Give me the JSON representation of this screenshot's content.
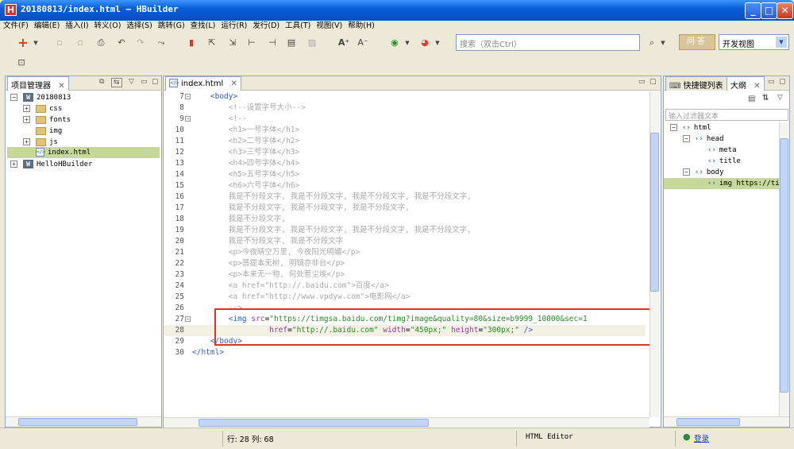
{
  "window": {
    "title": "20180813/index.html — HBuilder",
    "logo_letter": "H",
    "controls": {
      "minimize": "_",
      "maximize": "□",
      "close": "✕"
    }
  },
  "menu": [
    "文件(F)",
    "编辑(E)",
    "插入(I)",
    "转义(O)",
    "选择(S)",
    "跳转(G)",
    "查找(L)",
    "运行(R)",
    "发行(D)",
    "工具(T)",
    "视图(V)",
    "帮助(H)"
  ],
  "toolbar": {
    "search_placeholder": "搜索（双击Ctrl）",
    "qa_button": "问答",
    "view_select": "开发视图",
    "icons": [
      "new-icon",
      "save-icon",
      "save-all-icon",
      "print-icon",
      "undo-icon",
      "redo-icon",
      "format-icon",
      "bookmark-icon",
      "goto-icon",
      "navigate-icon",
      "prev-icon",
      "next-icon",
      "terminal-icon",
      "disabled-icon",
      "font-increase-icon",
      "font-decrease-icon",
      "run-icon",
      "chrome-icon",
      "search-icon"
    ]
  },
  "project_panel": {
    "tab": "项目管理器",
    "tree": [
      {
        "label": "20180813",
        "kind": "project",
        "expanded": true
      },
      {
        "label": "css",
        "kind": "folder"
      },
      {
        "label": "fonts",
        "kind": "folder"
      },
      {
        "label": "img",
        "kind": "folder"
      },
      {
        "label": "js",
        "kind": "folder"
      },
      {
        "label": "index.html",
        "kind": "file",
        "selected": true
      },
      {
        "label": "HelloHBuilder",
        "kind": "project",
        "expanded": false
      }
    ]
  },
  "editor": {
    "tab": "index.html",
    "lines": [
      {
        "n": "7",
        "fold": "−",
        "html": "    <span class='t'>&lt;body&gt;</span>"
      },
      {
        "n": "8",
        "html": "        <span class='c'>&lt;!--设置字号大小--&gt;</span>"
      },
      {
        "n": "9",
        "fold": "−",
        "html": "        <span class='c'>&lt;!--</span>"
      },
      {
        "n": "10",
        "html": "        <span class='c'>&lt;h1&gt;一号字体&lt;/h1&gt;</span>"
      },
      {
        "n": "11",
        "html": "        <span class='c'>&lt;h2&gt;二号字体&lt;/h2&gt;</span>"
      },
      {
        "n": "12",
        "html": "        <span class='c'>&lt;h3&gt;三号字体&lt;/h3&gt;</span>"
      },
      {
        "n": "13",
        "html": "        <span class='c'>&lt;h4&gt;四号字体&lt;/h4&gt;</span>"
      },
      {
        "n": "14",
        "html": "        <span class='c'>&lt;h5&gt;五号字体&lt;/h5&gt;</span>"
      },
      {
        "n": "15",
        "html": "        <span class='c'>&lt;h6&gt;六号字体&lt;/h6&gt;</span>"
      },
      {
        "n": "16",
        "html": "        <span class='c'>我是不分段文字, 我是不分段文字, 我是不分段文字, 我是不分段文字,</span>"
      },
      {
        "n": "17",
        "html": "        <span class='c'>我是不分段文字, 我是不分段文字, 我是不分段文字,</span>"
      },
      {
        "n": "18",
        "html": "        <span class='c'>我是不分段文字,</span>"
      },
      {
        "n": "19",
        "html": "        <span class='c'>我是不分段文字, 我是不分段文字, 我是不分段文字, 我是不分段文字,</span>"
      },
      {
        "n": "20",
        "html": "        <span class='c'>我是不分段文字, 我是不分段文字</span>"
      },
      {
        "n": "21",
        "html": "        <span class='c'>&lt;p&gt;今夜晴空万里, 今夜阳光明媚&lt;/p&gt;</span>"
      },
      {
        "n": "22",
        "html": "        <span class='c'>&lt;p&gt;菩提本无树, 明镜亦非台&lt;/p&gt;</span>"
      },
      {
        "n": "23",
        "html": "        <span class='c'>&lt;p&gt;本来无一物, 何处惹尘埃&lt;/p&gt;</span>"
      },
      {
        "n": "24",
        "html": "        <span class='c'>&lt;a href=\"http://.baidu.com\"&gt;百度&lt;/a&gt;</span>"
      },
      {
        "n": "25",
        "html": "        <span class='c'>&lt;a href=\"http://www.vpdyw.com\"&gt;电影网&lt;/a&gt;</span>"
      },
      {
        "n": "26",
        "html": "        <span class='c'>--&gt;</span>"
      },
      {
        "n": "27",
        "fold": "−",
        "html": "        <span class='t'>&lt;img</span> <span class='a'>src</span>=<span class='s'>\"https://timgsa.baidu.com/timg?image&amp;quality=80&amp;size=b9999_10000&amp;sec=1</span>"
      },
      {
        "n": "28",
        "hl": true,
        "html": "                 <span class='a'>href</span>=<span class='s'>\"http://.baidu.com\"</span> <span class='a'>width</span>=<span class='s'>\"450px;\"</span> <span class='a'>height</span>=<span class='s'>\"300px;\"</span> <span class='t'>/&gt;</span>"
      },
      {
        "n": "29",
        "html": "    <span class='t'>&lt;/body&gt;</span>"
      },
      {
        "n": "30",
        "html": "<span class='t'>&lt;/html&gt;</span>"
      }
    ]
  },
  "outline_panel": {
    "tabs": [
      "快捷键列表",
      "大纲"
    ],
    "filter_placeholder": "输入过滤器文本",
    "tree": [
      {
        "label": "html",
        "level": 0,
        "exp": "−"
      },
      {
        "label": "head",
        "level": 1,
        "exp": "−"
      },
      {
        "label": "meta",
        "level": 2
      },
      {
        "label": "title",
        "level": 2
      },
      {
        "label": "body",
        "level": 1,
        "exp": "−"
      },
      {
        "label": "img https://timgsa",
        "level": 2,
        "selected": true
      }
    ]
  },
  "status": {
    "position": "行: 28 列: 68",
    "editor_type": "HTML Editor",
    "login": "登录"
  },
  "colors": {
    "highlight_box": "#e0322a",
    "selection": "#c7d99a",
    "title_bar": "#0a5fd8"
  }
}
